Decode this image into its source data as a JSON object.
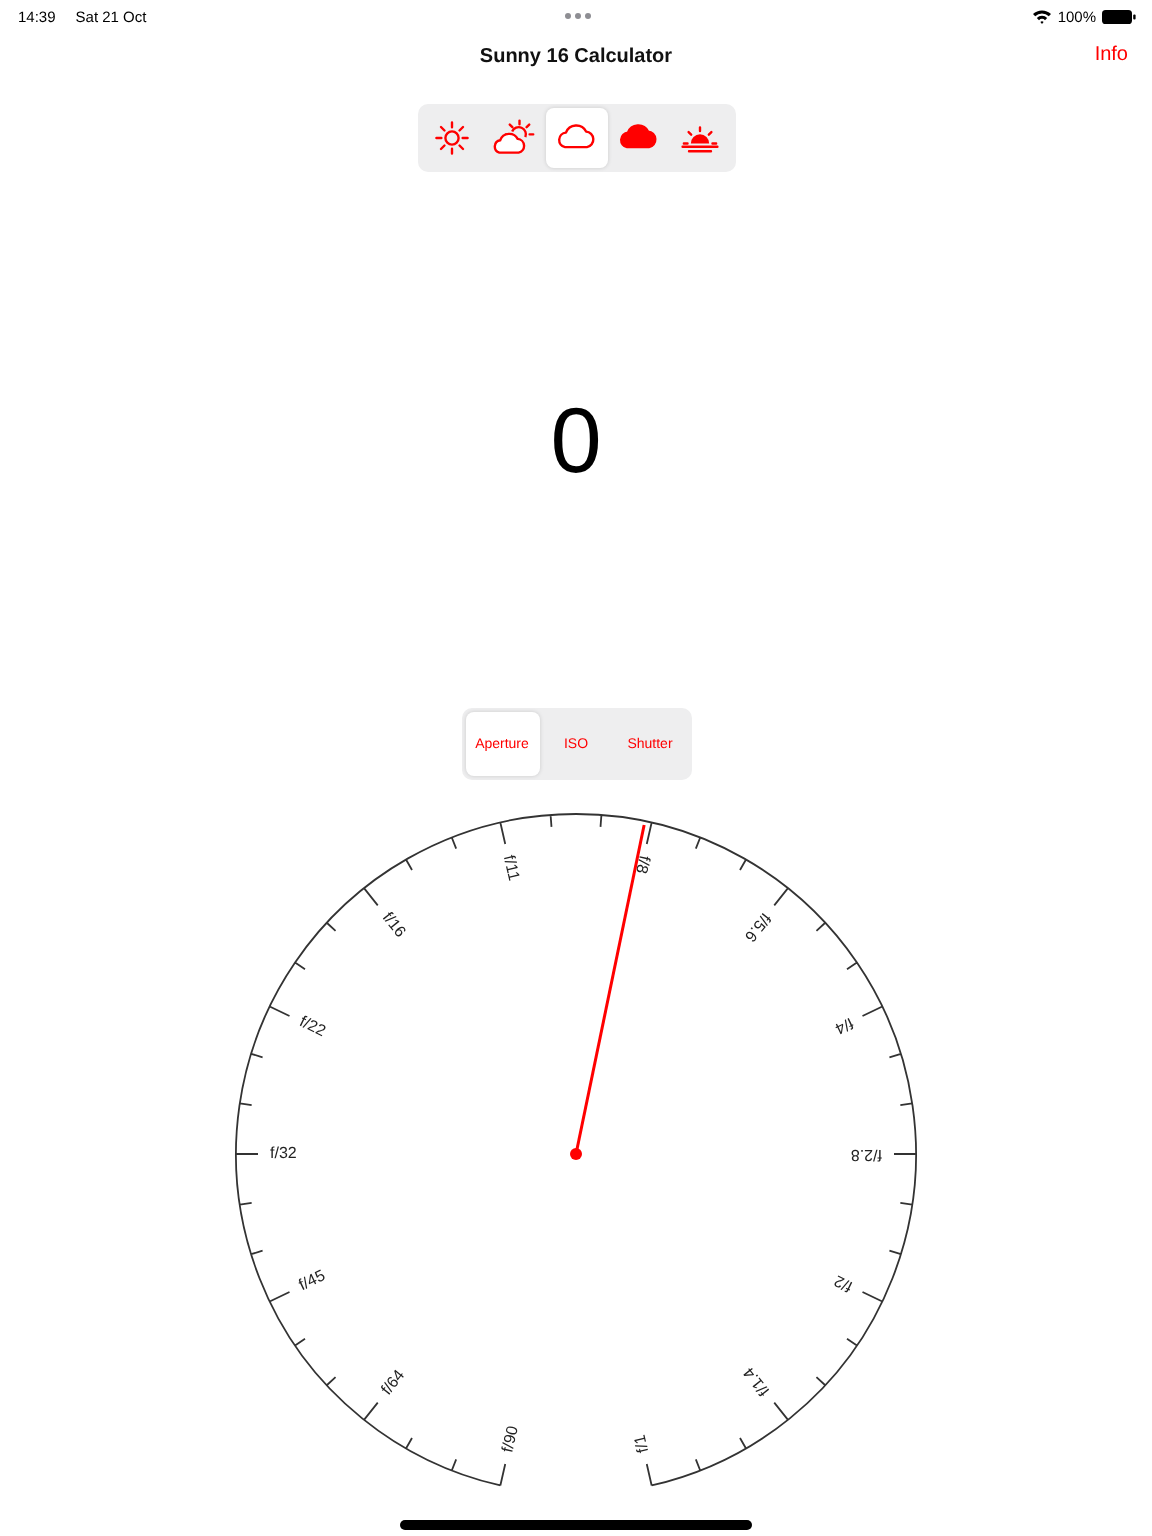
{
  "status_bar": {
    "time": "14:39",
    "date": "Sat 21 Oct",
    "battery": "100%"
  },
  "nav": {
    "title": "Sunny 16 Calculator",
    "action": "Info"
  },
  "conditions": [
    {
      "kind": "sun",
      "selected": false
    },
    {
      "kind": "partly-cloudy",
      "selected": false
    },
    {
      "kind": "cloud",
      "selected": true
    },
    {
      "kind": "heavy-cloud",
      "selected": false
    },
    {
      "kind": "sunset",
      "selected": false
    }
  ],
  "result": "0",
  "modes": [
    {
      "label": "Aperture",
      "selected": true
    },
    {
      "label": "ISO",
      "selected": false
    },
    {
      "label": "Shutter",
      "selected": false
    }
  ],
  "dial": {
    "level": 0.535,
    "labels": [
      "f/90",
      "f/64",
      "f/45",
      "f/32",
      "f/22",
      "f/16",
      "f/11",
      "f/8",
      "f/5.6",
      "f/4",
      "f/2.8",
      "f/2",
      "f/1.4",
      "f/1"
    ]
  }
}
